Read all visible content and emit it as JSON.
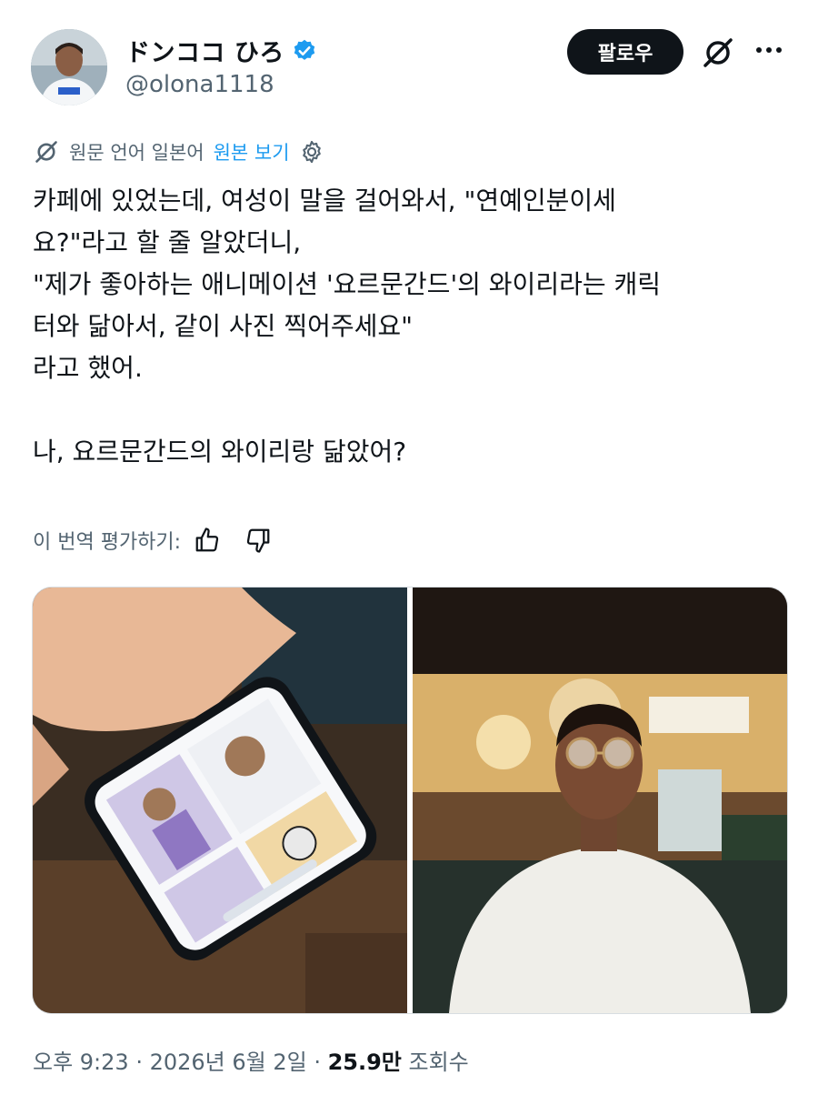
{
  "author": {
    "display_name": "ドンココ ひろ",
    "handle": "@olona1118"
  },
  "actions": {
    "follow_label": "팔로우"
  },
  "translation": {
    "source_note": "원문 언어 일본어",
    "show_original": "원본 보기"
  },
  "post": {
    "text": "카페에 있었는데, 여성이 말을 걸어와서, \"연예인분이세\n요?\"라고 할 줄 알았더니,\n\"제가 좋아하는 애니메이션 '요르문간드'의 와이리라는 캐릭\n터와 닮아서, 같이 사진 찍어주세요\"\n라고 했어.\n\n나, 요르문간드의 와이리랑 닮았어?"
  },
  "rating": {
    "label": "이 번역 평가하기:"
  },
  "meta": {
    "time": "오후 9:23",
    "separator1": " · ",
    "date": "2026년 6월 2일",
    "separator2": " · ",
    "views_count": "25.9만",
    "views_label": " 조회수"
  },
  "colors": {
    "accent": "#1d9bf0",
    "text_primary": "#0f1419",
    "text_secondary": "#536471"
  }
}
